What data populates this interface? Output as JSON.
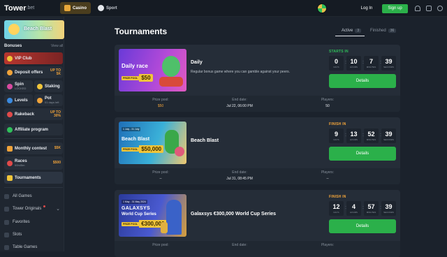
{
  "topbar": {
    "logo": "Tower",
    "logo_suffix": ".bet",
    "tabs": [
      {
        "label": "Casino",
        "active": true
      },
      {
        "label": "Sport",
        "active": false
      }
    ],
    "login_label": "Log In",
    "signup_label": "Sign up",
    "accent": "#2bb04a"
  },
  "sidebar": {
    "promo_label": "Beach Blast",
    "section_title": "Bonuses",
    "view_all": "View all",
    "items": {
      "vip": {
        "label": "VIP Club"
      },
      "deposit": {
        "label": "Deposit offers",
        "badge_top": "UP TO",
        "badge_val": "5K"
      },
      "spin": {
        "label": "Spin",
        "sub": "LOCKED"
      },
      "staking": {
        "label": "Staking"
      },
      "levels": {
        "label": "Levels"
      },
      "pot": {
        "label": "Pot",
        "sub": "01 days left"
      },
      "rakeback": {
        "label": "Rakeback",
        "badge_top": "UP TO",
        "badge_val": "30%"
      },
      "affiliate": {
        "label": "Affiliate program"
      },
      "monthly": {
        "label": "Monthly contest",
        "badge_val": "$5K"
      },
      "races": {
        "label": "Races",
        "sub": "00h45m",
        "badge_val": "$500"
      },
      "tournaments": {
        "label": "Tournaments"
      }
    },
    "games": [
      "All Games",
      "Tower Originals",
      "Favorites",
      "Slots",
      "Table Games"
    ]
  },
  "main": {
    "title": "Tournaments",
    "filters": [
      {
        "label": "Active",
        "count": "3"
      },
      {
        "label": "Finished",
        "count": "36"
      }
    ],
    "footer_labels": {
      "pool": "Prize pool:",
      "end": "End date:",
      "players": "Players:"
    },
    "units": {
      "d": "DAYS",
      "h": "HOURS",
      "m": "MINUTES",
      "s": "SECONDS"
    },
    "details_label": "Details",
    "cards": [
      {
        "banner_title": "Daily race",
        "banner_pool_label": "PRIZE POOL",
        "banner_pool": "$50",
        "banner_date": "",
        "name": "Daily",
        "description": "Regular bonus game where you can gamble against your peers.",
        "status": "STARTS IN",
        "countdown": {
          "d": "0",
          "h": "10",
          "m": "7",
          "s": "39"
        },
        "prize_pool": "$50",
        "end_date": "Jul 22, 06:00 PM",
        "players": "50"
      },
      {
        "banner_title": "Beach Blast",
        "banner_pool_label": "PRIZE POOL",
        "banner_pool": "$50,000",
        "banner_date": "1 July - 31 July",
        "name": "Beach Blast",
        "description": "",
        "status": "FINISH IN",
        "countdown": {
          "d": "9",
          "h": "13",
          "m": "52",
          "s": "39"
        },
        "prize_pool": "--",
        "end_date": "Jul 31, 08:45 PM",
        "players": "--"
      },
      {
        "banner_title": "World Cup Series",
        "banner_brand": "GALAXSYS",
        "banner_pool_label": "PRIZE POOL",
        "banner_pool": "€300,000",
        "banner_date": "1 May - 31 May 2024",
        "name": "Galaxsys €300,000 World Cup Series",
        "description": "",
        "status": "FINISH IN",
        "countdown": {
          "d": "12",
          "h": "4",
          "m": "57",
          "s": "39"
        },
        "prize_pool": "",
        "end_date": "",
        "players": ""
      }
    ]
  }
}
